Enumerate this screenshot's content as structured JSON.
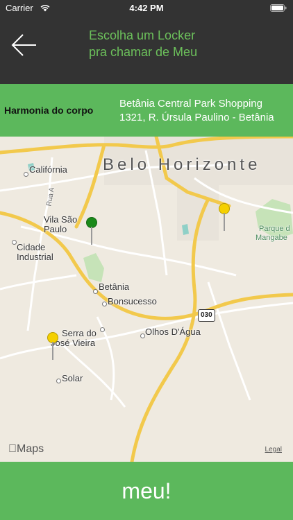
{
  "status_bar": {
    "carrier": "Carrier",
    "time": "4:42 PM"
  },
  "header": {
    "title_line1": "Escolha um Locker",
    "title_line2": "pra chamar de Meu",
    "back_icon": "arrow-left-icon"
  },
  "store": {
    "name": "Harmonia do corpo",
    "address_line1": "Betânia Central Park Shopping",
    "address_line2": "1321, R. Úrsula Paulino - Betânia"
  },
  "map": {
    "labels": {
      "city": "Belo Horizonte",
      "california": "Califórnia",
      "rua_a": "Rua A",
      "vila_sao_paulo_1": "Vila São",
      "vila_sao_paulo_2": "Paulo",
      "cidade_industrial_1": "Cidade",
      "cidade_industrial_2": "Industrial",
      "betania": "Betânia",
      "bonsucesso": "Bonsucesso",
      "olhos_dagua": "Olhos D'Água",
      "serra_1": "Serra do",
      "serra_2": "José Vieira",
      "solar": "Solar",
      "parque_1": "Parque d",
      "parque_2": "Mangabe",
      "road_030": "030"
    },
    "pins": [
      {
        "color": "green",
        "hex": "#1a8a1a"
      },
      {
        "color": "yellow",
        "hex": "#f5d000"
      },
      {
        "color": "yellow",
        "hex": "#f5d000"
      }
    ],
    "maps_logo": "Maps",
    "legal": "Legal"
  },
  "colors": {
    "header_bg": "#333333",
    "accent_green": "#5cb85c",
    "title_green": "#6cc05b"
  },
  "action": {
    "button_label": "meu!"
  }
}
